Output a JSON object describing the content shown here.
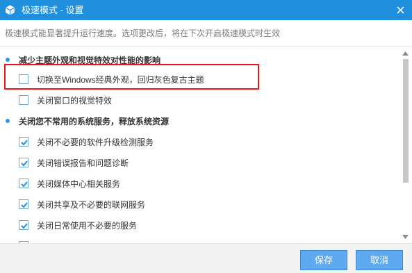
{
  "window": {
    "title": "极速模式 - 设置",
    "logo_icon": "cube-logo-icon",
    "close_icon": "close-icon"
  },
  "description": "极速模式能显著提升运行速度。选项更改后，将在下次开启极速模式时生效",
  "sections": [
    {
      "title": "减少主题外观和视觉特效对性能的影响",
      "options": [
        {
          "label": "切换至Windows经典外观，回归灰色复古主题",
          "checked": false,
          "highlighted": true
        },
        {
          "label": "关闭窗口的视觉特效",
          "checked": false
        }
      ]
    },
    {
      "title": "关闭您不常用的系统服务，释放系统资源",
      "options": [
        {
          "label": "关闭不必要的软件升级检测服务",
          "checked": true
        },
        {
          "label": "关闭错误报告和问题诊断",
          "checked": true
        },
        {
          "label": "关闭媒体中心相关服务",
          "checked": true
        },
        {
          "label": "关闭共享及不必要的联网服务",
          "checked": true
        },
        {
          "label": "关闭日常使用不必要的服务",
          "checked": true
        }
      ]
    }
  ],
  "buttons": {
    "save": "保存",
    "cancel": "取消"
  },
  "colors": {
    "titlebar": "#1f8fde",
    "accent": "#2f97e4",
    "button": "#5fa9ee",
    "highlight": "#e8161b"
  }
}
